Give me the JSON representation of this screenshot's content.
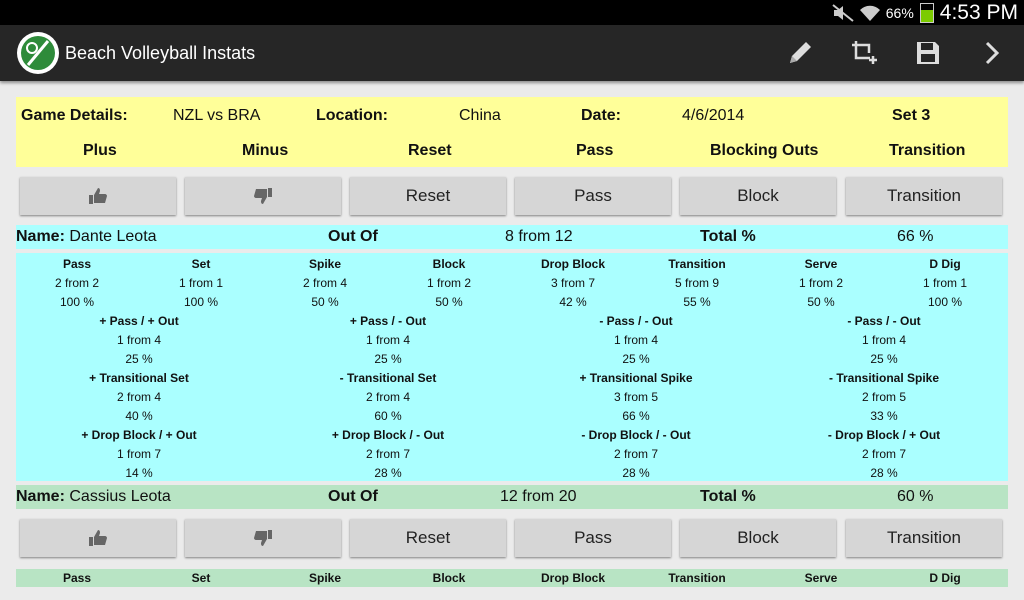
{
  "status": {
    "battery": "66%",
    "time": "4:53 PM"
  },
  "app": {
    "title": "Beach Volleyball Instats"
  },
  "actionbar_icons": [
    "pencil-icon",
    "crop-add-icon",
    "save-icon",
    "chevron-right-icon"
  ],
  "game": {
    "label": "Game Details:",
    "match": "NZL vs BRA",
    "location_label": "Location:",
    "location": "China",
    "date_label": "Date:",
    "date": "4/6/2014",
    "set": "Set 3"
  },
  "headers": {
    "plus": "Plus",
    "minus": "Minus",
    "reset": "Reset",
    "pass": "Pass",
    "blocking_outs": "Blocking Outs",
    "transition": "Transition"
  },
  "buttons": {
    "reset": "Reset",
    "pass": "Pass",
    "block": "Block",
    "transition": "Transition"
  },
  "player1": {
    "name_label": "Name:",
    "name": "Dante Leota",
    "outof_label": "Out Of",
    "outof": "8 from 12",
    "total_label": "Total %",
    "total": "66 %",
    "stats": [
      {
        "h": "Pass",
        "a": "2 from 2",
        "p": "100 %"
      },
      {
        "h": "Set",
        "a": "1 from 1",
        "p": "100 %"
      },
      {
        "h": "Spike",
        "a": "2 from 4",
        "p": "50 %"
      },
      {
        "h": "Block",
        "a": "1 from 2",
        "p": "50 %"
      },
      {
        "h": "Drop Block",
        "a": "3 from 7",
        "p": "42 %"
      },
      {
        "h": "Transition",
        "a": "5 from 9",
        "p": "55 %"
      },
      {
        "h": "Serve",
        "a": "1 from 2",
        "p": "50 %"
      },
      {
        "h": "D Dig",
        "a": "1 from 1",
        "p": "100 %"
      }
    ],
    "sub": [
      [
        {
          "h": "+ Pass / + Out",
          "a": "1 from 4",
          "p": "25 %"
        },
        {
          "h": "+ Pass / - Out",
          "a": "1 from 4",
          "p": "25 %"
        },
        {
          "h": "- Pass / - Out",
          "a": "1 from 4",
          "p": "25 %"
        },
        {
          "h": "- Pass / - Out",
          "a": "1 from 4",
          "p": "25 %"
        }
      ],
      [
        {
          "h": "+ Transitional Set",
          "a": "2 from 4",
          "p": "40 %"
        },
        {
          "h": "- Transitional Set",
          "a": "2 from 4",
          "p": "60 %"
        },
        {
          "h": "+ Transitional Spike",
          "a": "3 from 5",
          "p": "66 %"
        },
        {
          "h": "- Transitional Spike",
          "a": "2 from 5",
          "p": "33 %"
        }
      ],
      [
        {
          "h": "+ Drop Block / + Out",
          "a": "1 from 7",
          "p": "14 %"
        },
        {
          "h": "+ Drop Block / - Out",
          "a": "2 from 7",
          "p": "28 %"
        },
        {
          "h": "- Drop Block / - Out",
          "a": "2 from 7",
          "p": "28 %"
        },
        {
          "h": "- Drop Block / + Out",
          "a": "2 from 7",
          "p": "28 %"
        }
      ]
    ]
  },
  "player2": {
    "name_label": "Name:",
    "name": "Cassius Leota",
    "outof_label": "Out Of",
    "outof": "12 from 20",
    "total_label": "Total %",
    "total": "60 %",
    "headers": [
      "Pass",
      "Set",
      "Spike",
      "Block",
      "Drop Block",
      "Transition",
      "Serve",
      "D Dig"
    ]
  }
}
